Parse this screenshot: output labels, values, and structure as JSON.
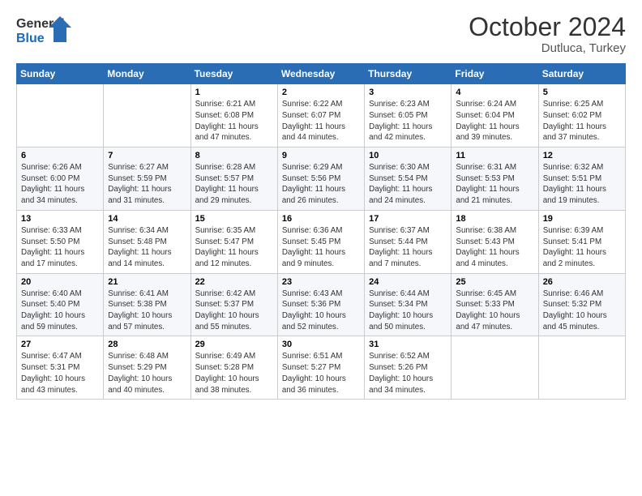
{
  "header": {
    "logo_line1": "General",
    "logo_line2": "Blue",
    "month": "October 2024",
    "location": "Dutluca, Turkey"
  },
  "weekdays": [
    "Sunday",
    "Monday",
    "Tuesday",
    "Wednesday",
    "Thursday",
    "Friday",
    "Saturday"
  ],
  "weeks": [
    [
      {
        "day": "",
        "info": ""
      },
      {
        "day": "",
        "info": ""
      },
      {
        "day": "1",
        "info": "Sunrise: 6:21 AM\nSunset: 6:08 PM\nDaylight: 11 hours and 47 minutes."
      },
      {
        "day": "2",
        "info": "Sunrise: 6:22 AM\nSunset: 6:07 PM\nDaylight: 11 hours and 44 minutes."
      },
      {
        "day": "3",
        "info": "Sunrise: 6:23 AM\nSunset: 6:05 PM\nDaylight: 11 hours and 42 minutes."
      },
      {
        "day": "4",
        "info": "Sunrise: 6:24 AM\nSunset: 6:04 PM\nDaylight: 11 hours and 39 minutes."
      },
      {
        "day": "5",
        "info": "Sunrise: 6:25 AM\nSunset: 6:02 PM\nDaylight: 11 hours and 37 minutes."
      }
    ],
    [
      {
        "day": "6",
        "info": "Sunrise: 6:26 AM\nSunset: 6:00 PM\nDaylight: 11 hours and 34 minutes."
      },
      {
        "day": "7",
        "info": "Sunrise: 6:27 AM\nSunset: 5:59 PM\nDaylight: 11 hours and 31 minutes."
      },
      {
        "day": "8",
        "info": "Sunrise: 6:28 AM\nSunset: 5:57 PM\nDaylight: 11 hours and 29 minutes."
      },
      {
        "day": "9",
        "info": "Sunrise: 6:29 AM\nSunset: 5:56 PM\nDaylight: 11 hours and 26 minutes."
      },
      {
        "day": "10",
        "info": "Sunrise: 6:30 AM\nSunset: 5:54 PM\nDaylight: 11 hours and 24 minutes."
      },
      {
        "day": "11",
        "info": "Sunrise: 6:31 AM\nSunset: 5:53 PM\nDaylight: 11 hours and 21 minutes."
      },
      {
        "day": "12",
        "info": "Sunrise: 6:32 AM\nSunset: 5:51 PM\nDaylight: 11 hours and 19 minutes."
      }
    ],
    [
      {
        "day": "13",
        "info": "Sunrise: 6:33 AM\nSunset: 5:50 PM\nDaylight: 11 hours and 17 minutes."
      },
      {
        "day": "14",
        "info": "Sunrise: 6:34 AM\nSunset: 5:48 PM\nDaylight: 11 hours and 14 minutes."
      },
      {
        "day": "15",
        "info": "Sunrise: 6:35 AM\nSunset: 5:47 PM\nDaylight: 11 hours and 12 minutes."
      },
      {
        "day": "16",
        "info": "Sunrise: 6:36 AM\nSunset: 5:45 PM\nDaylight: 11 hours and 9 minutes."
      },
      {
        "day": "17",
        "info": "Sunrise: 6:37 AM\nSunset: 5:44 PM\nDaylight: 11 hours and 7 minutes."
      },
      {
        "day": "18",
        "info": "Sunrise: 6:38 AM\nSunset: 5:43 PM\nDaylight: 11 hours and 4 minutes."
      },
      {
        "day": "19",
        "info": "Sunrise: 6:39 AM\nSunset: 5:41 PM\nDaylight: 11 hours and 2 minutes."
      }
    ],
    [
      {
        "day": "20",
        "info": "Sunrise: 6:40 AM\nSunset: 5:40 PM\nDaylight: 10 hours and 59 minutes."
      },
      {
        "day": "21",
        "info": "Sunrise: 6:41 AM\nSunset: 5:38 PM\nDaylight: 10 hours and 57 minutes."
      },
      {
        "day": "22",
        "info": "Sunrise: 6:42 AM\nSunset: 5:37 PM\nDaylight: 10 hours and 55 minutes."
      },
      {
        "day": "23",
        "info": "Sunrise: 6:43 AM\nSunset: 5:36 PM\nDaylight: 10 hours and 52 minutes."
      },
      {
        "day": "24",
        "info": "Sunrise: 6:44 AM\nSunset: 5:34 PM\nDaylight: 10 hours and 50 minutes."
      },
      {
        "day": "25",
        "info": "Sunrise: 6:45 AM\nSunset: 5:33 PM\nDaylight: 10 hours and 47 minutes."
      },
      {
        "day": "26",
        "info": "Sunrise: 6:46 AM\nSunset: 5:32 PM\nDaylight: 10 hours and 45 minutes."
      }
    ],
    [
      {
        "day": "27",
        "info": "Sunrise: 6:47 AM\nSunset: 5:31 PM\nDaylight: 10 hours and 43 minutes."
      },
      {
        "day": "28",
        "info": "Sunrise: 6:48 AM\nSunset: 5:29 PM\nDaylight: 10 hours and 40 minutes."
      },
      {
        "day": "29",
        "info": "Sunrise: 6:49 AM\nSunset: 5:28 PM\nDaylight: 10 hours and 38 minutes."
      },
      {
        "day": "30",
        "info": "Sunrise: 6:51 AM\nSunset: 5:27 PM\nDaylight: 10 hours and 36 minutes."
      },
      {
        "day": "31",
        "info": "Sunrise: 6:52 AM\nSunset: 5:26 PM\nDaylight: 10 hours and 34 minutes."
      },
      {
        "day": "",
        "info": ""
      },
      {
        "day": "",
        "info": ""
      }
    ]
  ]
}
